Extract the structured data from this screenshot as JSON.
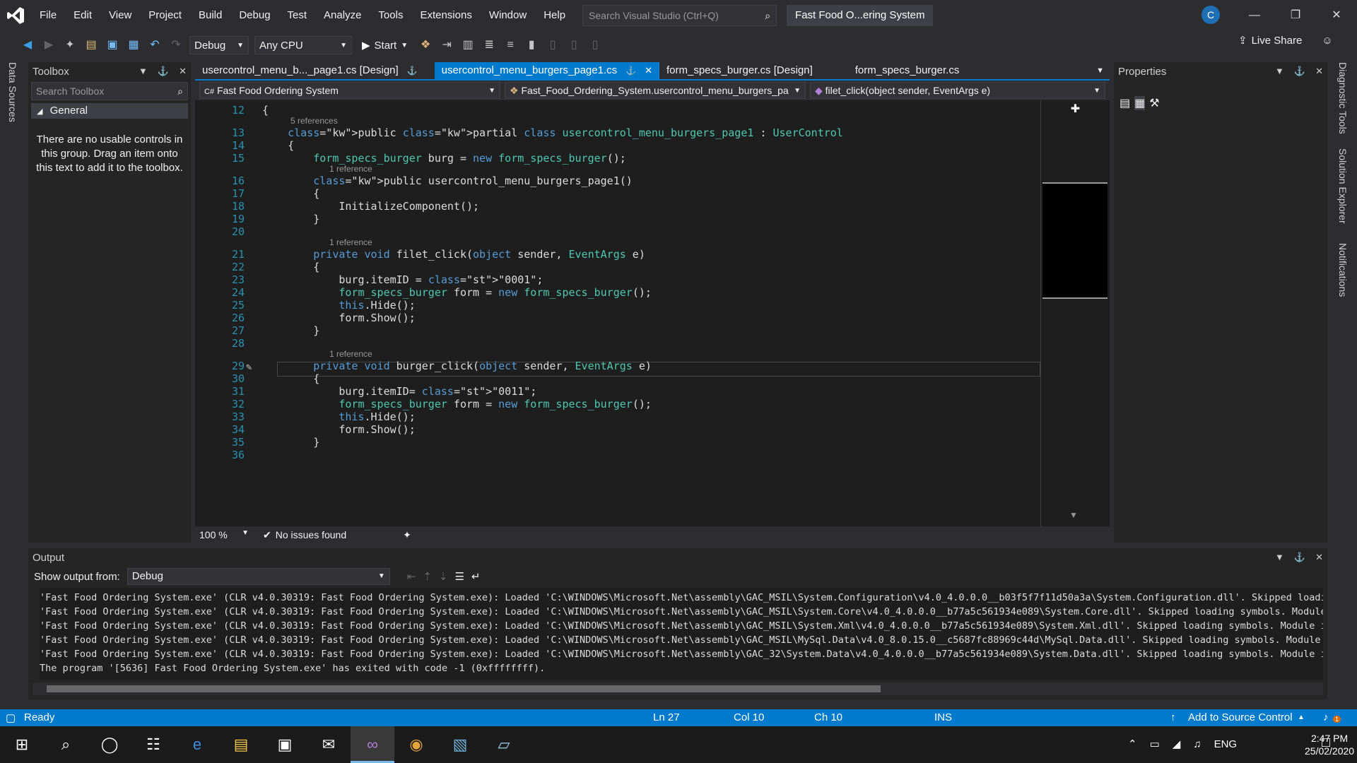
{
  "menu": {
    "items": [
      "File",
      "Edit",
      "View",
      "Project",
      "Build",
      "Debug",
      "Test",
      "Analyze",
      "Tools",
      "Extensions",
      "Window",
      "Help"
    ],
    "search_placeholder": "Search Visual Studio (Ctrl+Q)",
    "solution_title": "Fast Food O...ering System",
    "avatar": "C"
  },
  "toolbar": {
    "config": "Debug",
    "platform": "Any CPU",
    "start": "Start",
    "live_share": "Live Share"
  },
  "side": {
    "left": "Data Sources",
    "right": [
      "Diagnostic Tools",
      "Solution Explorer",
      "Notifications"
    ]
  },
  "toolbox": {
    "title": "Toolbox",
    "search_placeholder": "Search Toolbox",
    "group": "General",
    "empty_text": "There are no usable controls in this group. Drag an item onto this text to add it to the toolbox."
  },
  "tabs": [
    {
      "label": "usercontrol_menu_b..._page1.cs [Design]"
    },
    {
      "label": "usercontrol_menu_burgers_page1.cs"
    },
    {
      "label": "form_specs_burger.cs [Design]"
    },
    {
      "label": "form_specs_burger.cs"
    }
  ],
  "navbar": {
    "project": "Fast Food Ordering System",
    "class": "Fast_Food_Ordering_System.usercontrol_menu_burgers_pa",
    "member": "filet_click(object sender, EventArgs e)"
  },
  "code": {
    "line_numbers": [
      "12",
      "13",
      "14",
      "15",
      "16",
      "17",
      "18",
      "19",
      "20",
      "21",
      "22",
      "23",
      "24",
      "25",
      "26",
      "27",
      "28",
      "29",
      "30",
      "31",
      "32",
      "33",
      "34",
      "35",
      "36"
    ],
    "lens": [
      "5 references",
      "1 reference",
      "1 reference",
      "1 reference"
    ],
    "lines": [
      "{",
      "    public partial class usercontrol_menu_burgers_page1 : UserControl",
      "    {",
      "        form_specs_burger burg = new form_specs_burger();",
      "        public usercontrol_menu_burgers_page1()",
      "        {",
      "            InitializeComponent();",
      "        }",
      "",
      "        private void filet_click(object sender, EventArgs e)",
      "        {",
      "            burg.itemID = \"0001\";",
      "            form_specs_burger form = new form_specs_burger();",
      "            this.Hide();",
      "            form.Show();",
      "        }",
      "",
      "        private void burger_click(object sender, EventArgs e)",
      "        {",
      "            burg.itemID= \"0011\";",
      "            form_specs_burger form = new form_specs_burger();",
      "            this.Hide();",
      "            form.Show();",
      "        }",
      ""
    ]
  },
  "editor_status": {
    "zoom": "100 %",
    "issues": "No issues found"
  },
  "properties": {
    "title": "Properties"
  },
  "output": {
    "title": "Output",
    "show_from_label": "Show output from:",
    "source": "Debug",
    "lines": [
      "'Fast Food Ordering System.exe' (CLR v4.0.30319: Fast Food Ordering System.exe): Loaded 'C:\\WINDOWS\\Microsoft.Net\\assembly\\GAC_MSIL\\System.Configuration\\v4.0_4.0.0.0__b03f5f7f11d50a3a\\System.Configuration.dll'. Skipped loadin",
      "'Fast Food Ordering System.exe' (CLR v4.0.30319: Fast Food Ordering System.exe): Loaded 'C:\\WINDOWS\\Microsoft.Net\\assembly\\GAC_MSIL\\System.Core\\v4.0_4.0.0.0__b77a5c561934e089\\System.Core.dll'. Skipped loading symbols. Module",
      "'Fast Food Ordering System.exe' (CLR v4.0.30319: Fast Food Ordering System.exe): Loaded 'C:\\WINDOWS\\Microsoft.Net\\assembly\\GAC_MSIL\\System.Xml\\v4.0_4.0.0.0__b77a5c561934e089\\System.Xml.dll'. Skipped loading symbols. Module is",
      "'Fast Food Ordering System.exe' (CLR v4.0.30319: Fast Food Ordering System.exe): Loaded 'C:\\WINDOWS\\Microsoft.Net\\assembly\\GAC_MSIL\\MySql.Data\\v4.0_8.0.15.0__c5687fc88969c44d\\MySql.Data.dll'. Skipped loading symbols. Module i",
      "'Fast Food Ordering System.exe' (CLR v4.0.30319: Fast Food Ordering System.exe): Loaded 'C:\\WINDOWS\\Microsoft.Net\\assembly\\GAC_32\\System.Data\\v4.0_4.0.0.0__b77a5c561934e089\\System.Data.dll'. Skipped loading symbols. Module i",
      "The program '[5636] Fast Food Ordering System.exe' has exited with code -1 (0xffffffff)."
    ]
  },
  "status": {
    "ready": "Ready",
    "ln": "Ln 27",
    "col": "Col 10",
    "ch": "Ch 10",
    "ins": "INS",
    "source_control": "Add to Source Control",
    "notif_count": "1"
  },
  "taskbar": {
    "lang": "ENG",
    "time": "2:47 PM",
    "date": "25/02/2020"
  },
  "colors": {
    "accent": "#007acc",
    "editor_bg": "#1e1e1e",
    "keyword": "#569cd6",
    "type": "#4ec9b0",
    "string": "#d69d85"
  }
}
